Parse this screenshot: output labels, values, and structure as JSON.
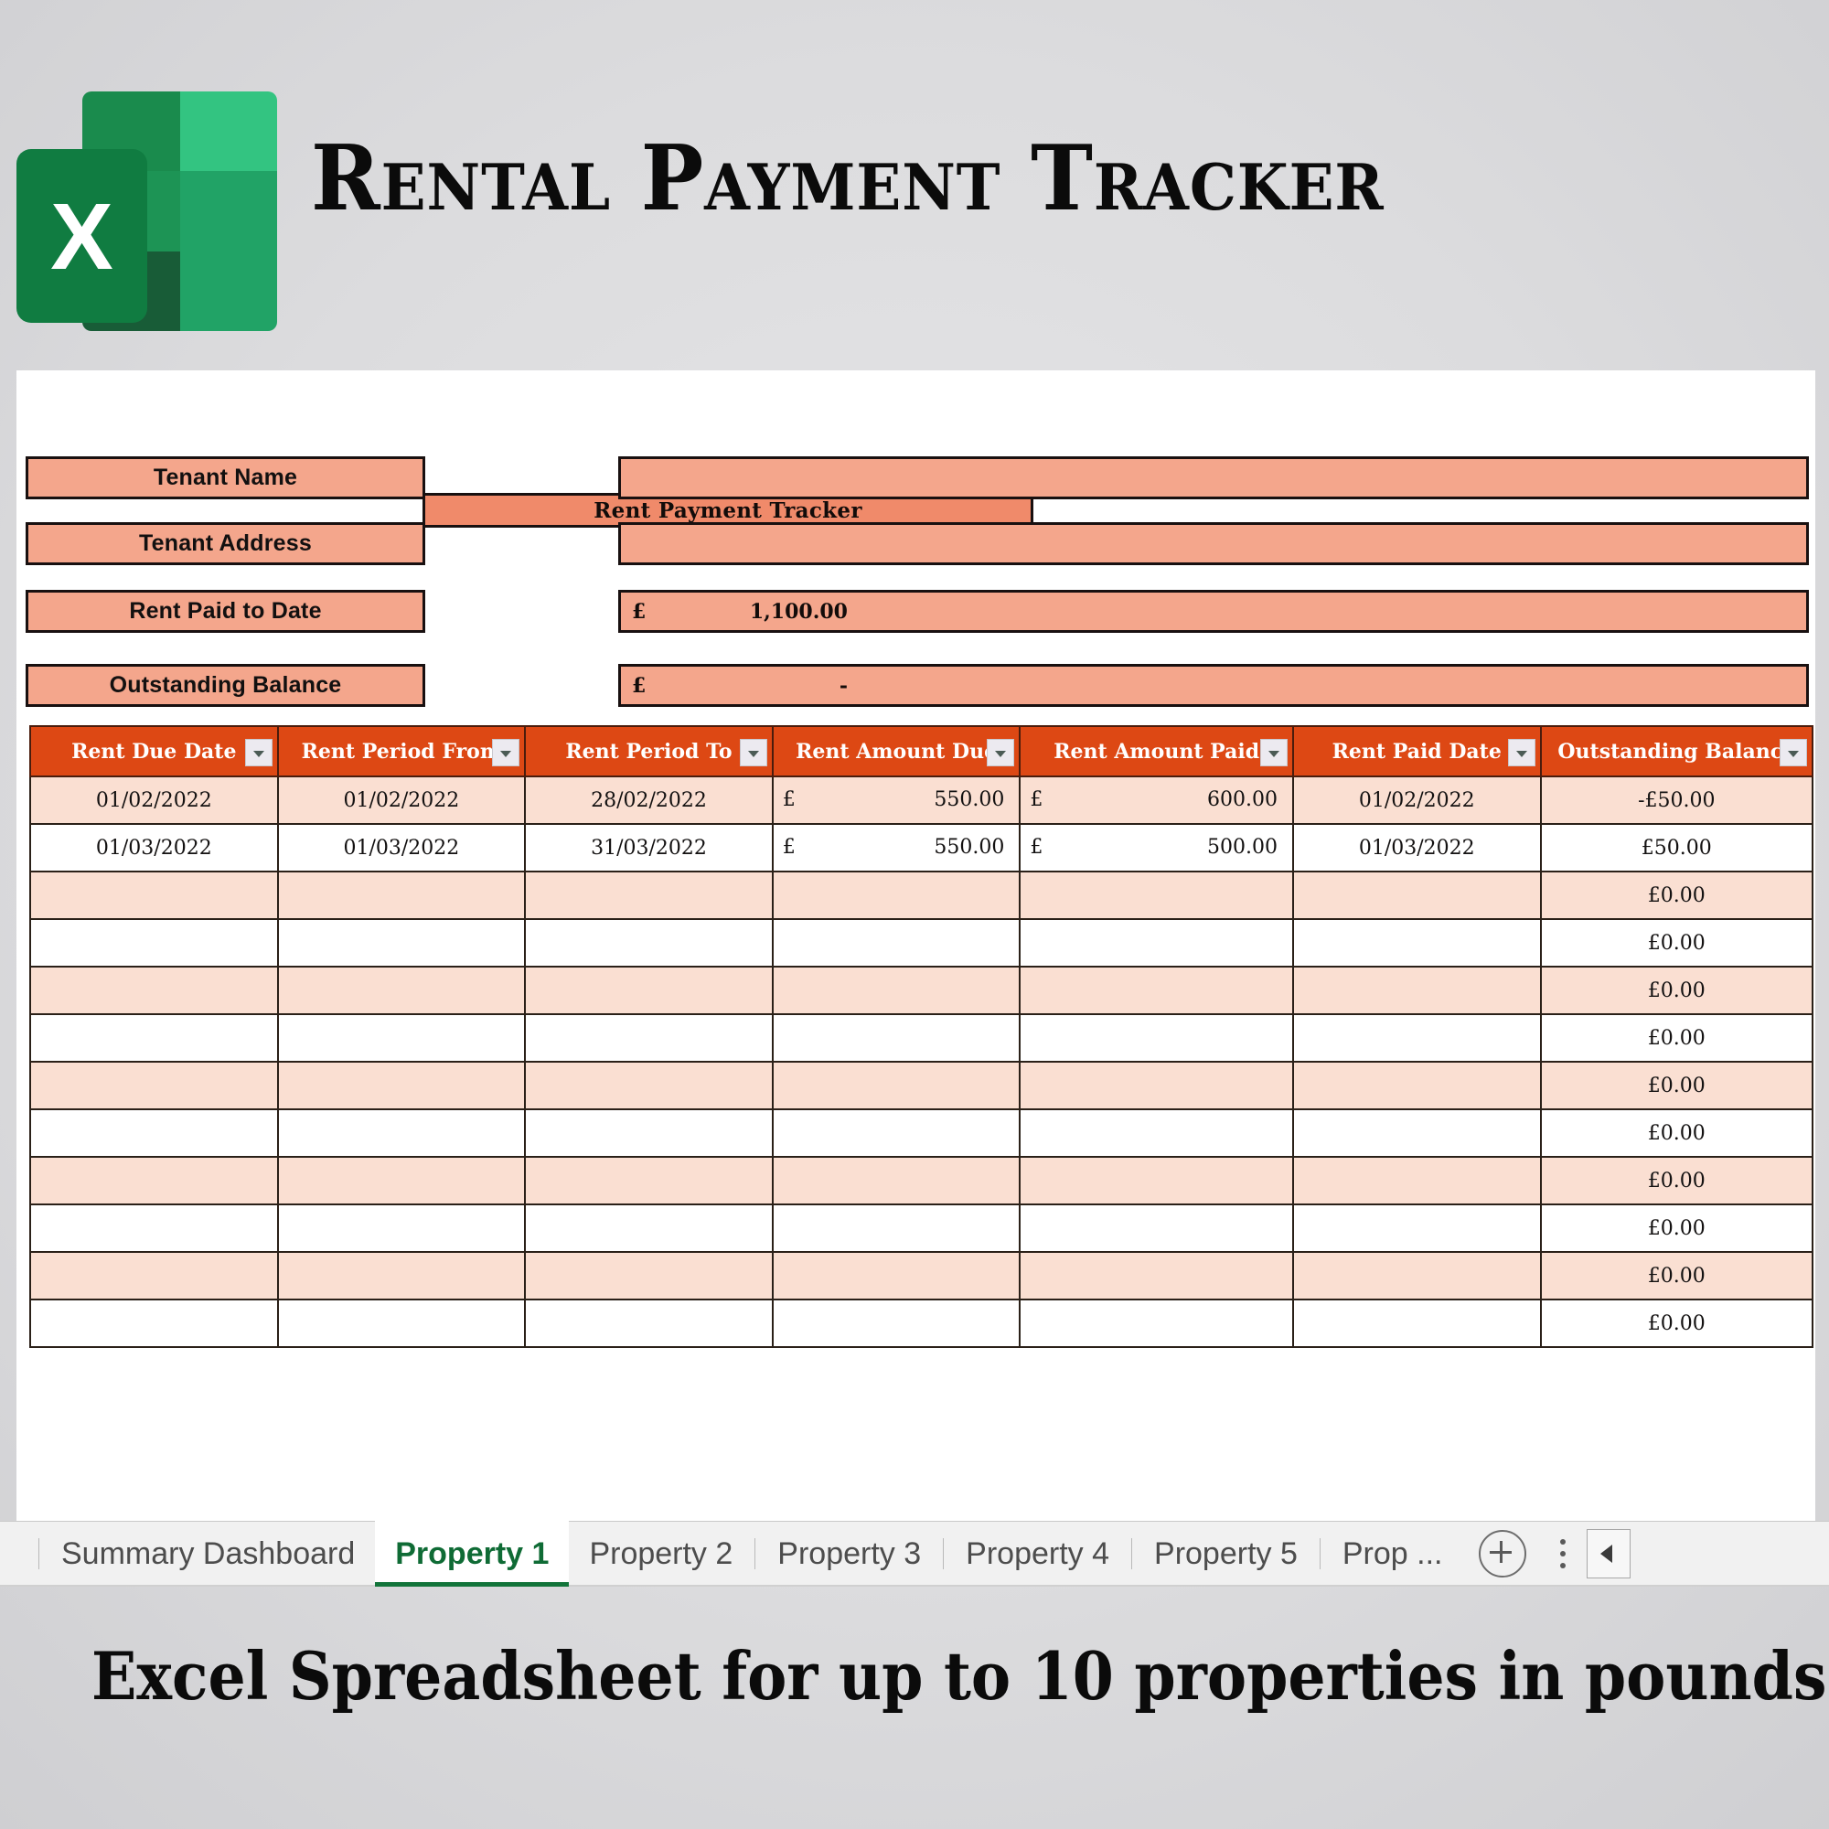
{
  "header": {
    "title": "Rental Payment Tracker",
    "logo_icon": "excel-logo-icon",
    "logo_letter": "X"
  },
  "spreadsheet": {
    "sheet_title": "Rent Payment Tracker",
    "fields": [
      {
        "label": "Tenant Name",
        "currency": "",
        "value": ""
      },
      {
        "label": "Tenant Address",
        "currency": "",
        "value": ""
      },
      {
        "label": "Rent Paid to Date",
        "currency": "£",
        "value": "1,100.00"
      },
      {
        "label": "Outstanding Balance",
        "currency": "£",
        "value": "-"
      }
    ],
    "table": {
      "columns": [
        "Rent Due Date",
        "Rent Period From",
        "Rent Period To",
        "Rent Amount Due",
        "Rent Amount Paid",
        "Rent Paid Date",
        "Outstanding Balance"
      ],
      "filter_icon": "chevron-down-icon",
      "rows": [
        {
          "due_date": "01/02/2022",
          "period_from": "01/02/2022",
          "period_to": "28/02/2022",
          "amount_due_cur": "£",
          "amount_due": "550.00",
          "amount_paid_cur": "£",
          "amount_paid": "600.00",
          "paid_date": "01/02/2022",
          "balance": "-£50.00"
        },
        {
          "due_date": "01/03/2022",
          "period_from": "01/03/2022",
          "period_to": "31/03/2022",
          "amount_due_cur": "£",
          "amount_due": "550.00",
          "amount_paid_cur": "£",
          "amount_paid": "500.00",
          "paid_date": "01/03/2022",
          "balance": "£50.00"
        },
        {
          "due_date": "",
          "period_from": "",
          "period_to": "",
          "amount_due_cur": "",
          "amount_due": "",
          "amount_paid_cur": "",
          "amount_paid": "",
          "paid_date": "",
          "balance": "£0.00"
        },
        {
          "due_date": "",
          "period_from": "",
          "period_to": "",
          "amount_due_cur": "",
          "amount_due": "",
          "amount_paid_cur": "",
          "amount_paid": "",
          "paid_date": "",
          "balance": "£0.00"
        },
        {
          "due_date": "",
          "period_from": "",
          "period_to": "",
          "amount_due_cur": "",
          "amount_due": "",
          "amount_paid_cur": "",
          "amount_paid": "",
          "paid_date": "",
          "balance": "£0.00"
        },
        {
          "due_date": "",
          "period_from": "",
          "period_to": "",
          "amount_due_cur": "",
          "amount_due": "",
          "amount_paid_cur": "",
          "amount_paid": "",
          "paid_date": "",
          "balance": "£0.00"
        },
        {
          "due_date": "",
          "period_from": "",
          "period_to": "",
          "amount_due_cur": "",
          "amount_due": "",
          "amount_paid_cur": "",
          "amount_paid": "",
          "paid_date": "",
          "balance": "£0.00"
        },
        {
          "due_date": "",
          "period_from": "",
          "period_to": "",
          "amount_due_cur": "",
          "amount_due": "",
          "amount_paid_cur": "",
          "amount_paid": "",
          "paid_date": "",
          "balance": "£0.00"
        },
        {
          "due_date": "",
          "period_from": "",
          "period_to": "",
          "amount_due_cur": "",
          "amount_due": "",
          "amount_paid_cur": "",
          "amount_paid": "",
          "paid_date": "",
          "balance": "£0.00"
        },
        {
          "due_date": "",
          "period_from": "",
          "period_to": "",
          "amount_due_cur": "",
          "amount_due": "",
          "amount_paid_cur": "",
          "amount_paid": "",
          "paid_date": "",
          "balance": "£0.00"
        },
        {
          "due_date": "",
          "period_from": "",
          "period_to": "",
          "amount_due_cur": "",
          "amount_due": "",
          "amount_paid_cur": "",
          "amount_paid": "",
          "paid_date": "",
          "balance": "£0.00"
        },
        {
          "due_date": "",
          "period_from": "",
          "period_to": "",
          "amount_due_cur": "",
          "amount_due": "",
          "amount_paid_cur": "",
          "amount_paid": "",
          "paid_date": "",
          "balance": "£0.00"
        }
      ]
    }
  },
  "sheet_tabs": {
    "items": [
      {
        "label": "Summary Dashboard",
        "active": false
      },
      {
        "label": "Property 1",
        "active": true
      },
      {
        "label": "Property 2",
        "active": false
      },
      {
        "label": "Property 3",
        "active": false
      },
      {
        "label": "Property 4",
        "active": false
      },
      {
        "label": "Property 5",
        "active": false
      },
      {
        "label": "Prop ...",
        "active": false
      }
    ],
    "add_label": "+",
    "add_icon": "plus-circle-icon",
    "more_icon": "kebab-menu-icon",
    "scroll_left_icon": "arrow-left-icon"
  },
  "footer": {
    "caption": "Excel Spreadsheet for up to 10 properties in pounds"
  },
  "colors": {
    "header_red": "#dd4814",
    "salmon": "#f4a68c",
    "light_salmon": "#fadfd2",
    "title_salmon": "#f08a6a",
    "excel_green": "#107c41",
    "tab_active_green": "#12743a"
  }
}
